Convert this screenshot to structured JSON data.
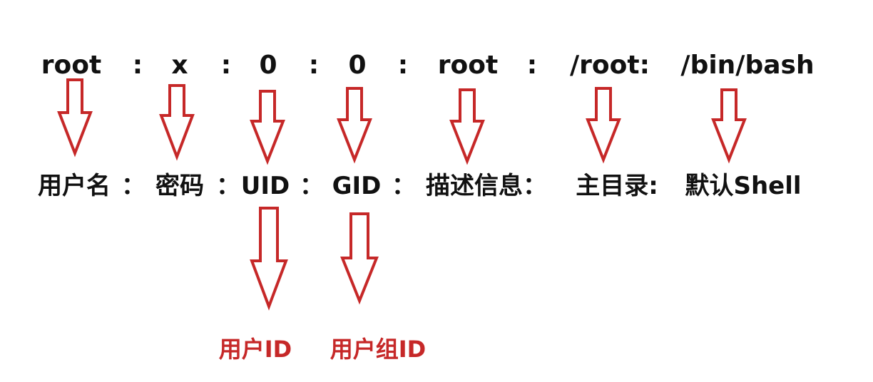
{
  "passwd_line": {
    "fields": [
      "root",
      "x",
      "0",
      "0",
      "root",
      "/root:",
      "/bin/bash"
    ],
    "separators": [
      ":",
      ":",
      ":",
      ":",
      ":"
    ]
  },
  "field_meanings": {
    "labels": [
      "用户名",
      "密码",
      "UID",
      "GID",
      "描述信息：",
      "主目录:",
      "默认Shell"
    ],
    "separators": [
      "：",
      "：",
      "：",
      "："
    ]
  },
  "id_meanings": {
    "labels": [
      "用户ID",
      "用户组ID"
    ]
  },
  "colors": {
    "text": "#111111",
    "arrow_stroke": "#c62828",
    "highlight_text": "#c62828"
  }
}
